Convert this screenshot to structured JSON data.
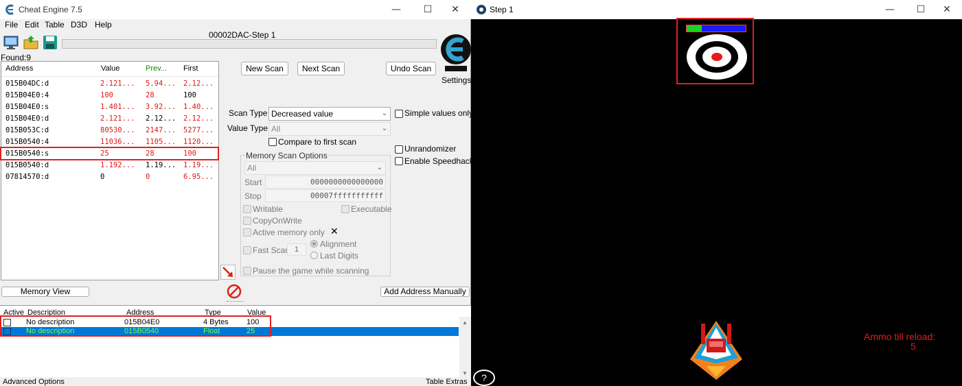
{
  "ce": {
    "title": "Cheat Engine 7.5",
    "menu": [
      "File",
      "Edit",
      "Table",
      "D3D",
      "Help"
    ],
    "process_title": "00002DAC-Step 1",
    "found_label": "Found:9",
    "settings_label": "Settings",
    "results": {
      "headers": [
        "Address",
        "Value",
        "Prev...",
        "First"
      ],
      "rows": [
        {
          "address": "015B04DC:d",
          "value": "2.121...",
          "prev": "5.94...",
          "first": "2.12..."
        },
        {
          "address": "015B04E0:4",
          "value": "100",
          "prev": "28",
          "first": "100"
        },
        {
          "address": "015B04E0:s",
          "value": "1.401...",
          "prev": "3.92...",
          "first": "1.40..."
        },
        {
          "address": "015B04E0:d",
          "value": "2.121...",
          "prev": "2.12...",
          "first": "2.12..."
        },
        {
          "address": "015B053C:d",
          "value": "80530...",
          "prev": "2147...",
          "first": "5277..."
        },
        {
          "address": "015B0540:4",
          "value": "11036...",
          "prev": "1105...",
          "first": "1120..."
        },
        {
          "address": "015B0540:s",
          "value": "25",
          "prev": "28",
          "first": "100"
        },
        {
          "address": "015B0540:d",
          "value": "1.192...",
          "prev": "1.19...",
          "first": "1.19..."
        },
        {
          "address": "07814570:d",
          "value": "0",
          "prev": "0",
          "first": "6.95..."
        }
      ]
    },
    "buttons": {
      "new_scan": "New Scan",
      "next_scan": "Next Scan",
      "undo_scan": "Undo Scan",
      "memory_view": "Memory View",
      "add_address": "Add Address Manually"
    },
    "scan_type_label": "Scan Type",
    "scan_type_value": "Decreased value",
    "value_type_label": "Value Type",
    "value_type_value": "All",
    "simple_values": "Simple values only",
    "compare_first": "Compare to first scan",
    "unrandomizer": "Unrandomizer",
    "speedhack": "Enable Speedhack",
    "memory_scan": {
      "legend": "Memory Scan Options",
      "region": "All",
      "start_label": "Start",
      "start_value": "0000000000000000",
      "stop_label": "Stop",
      "stop_value": "00007fffffffffff",
      "writable": "Writable",
      "executable": "Executable",
      "copyonwrite": "CopyOnWrite",
      "active_memory": "Active memory only",
      "fast_scan": "Fast Scan",
      "fast_scan_value": "1",
      "alignment": "Alignment",
      "last_digits": "Last Digits",
      "pause_game": "Pause the game while scanning"
    },
    "address_list": {
      "headers": [
        "Active",
        "Description",
        "Address",
        "Type",
        "Value"
      ],
      "rows": [
        {
          "description": "No description",
          "address": "015B04E0",
          "type": "4 Bytes",
          "value": "100"
        },
        {
          "description": "No description",
          "address": "015B0540",
          "type": "Float",
          "value": "25"
        }
      ]
    },
    "status_left": "Advanced Options",
    "status_right": "Table Extras"
  },
  "game": {
    "title": "Step 1",
    "ammo_label": "Ammo till reload:",
    "ammo_value": "5",
    "help_label": "?",
    "target_health_fraction": 0.25
  }
}
